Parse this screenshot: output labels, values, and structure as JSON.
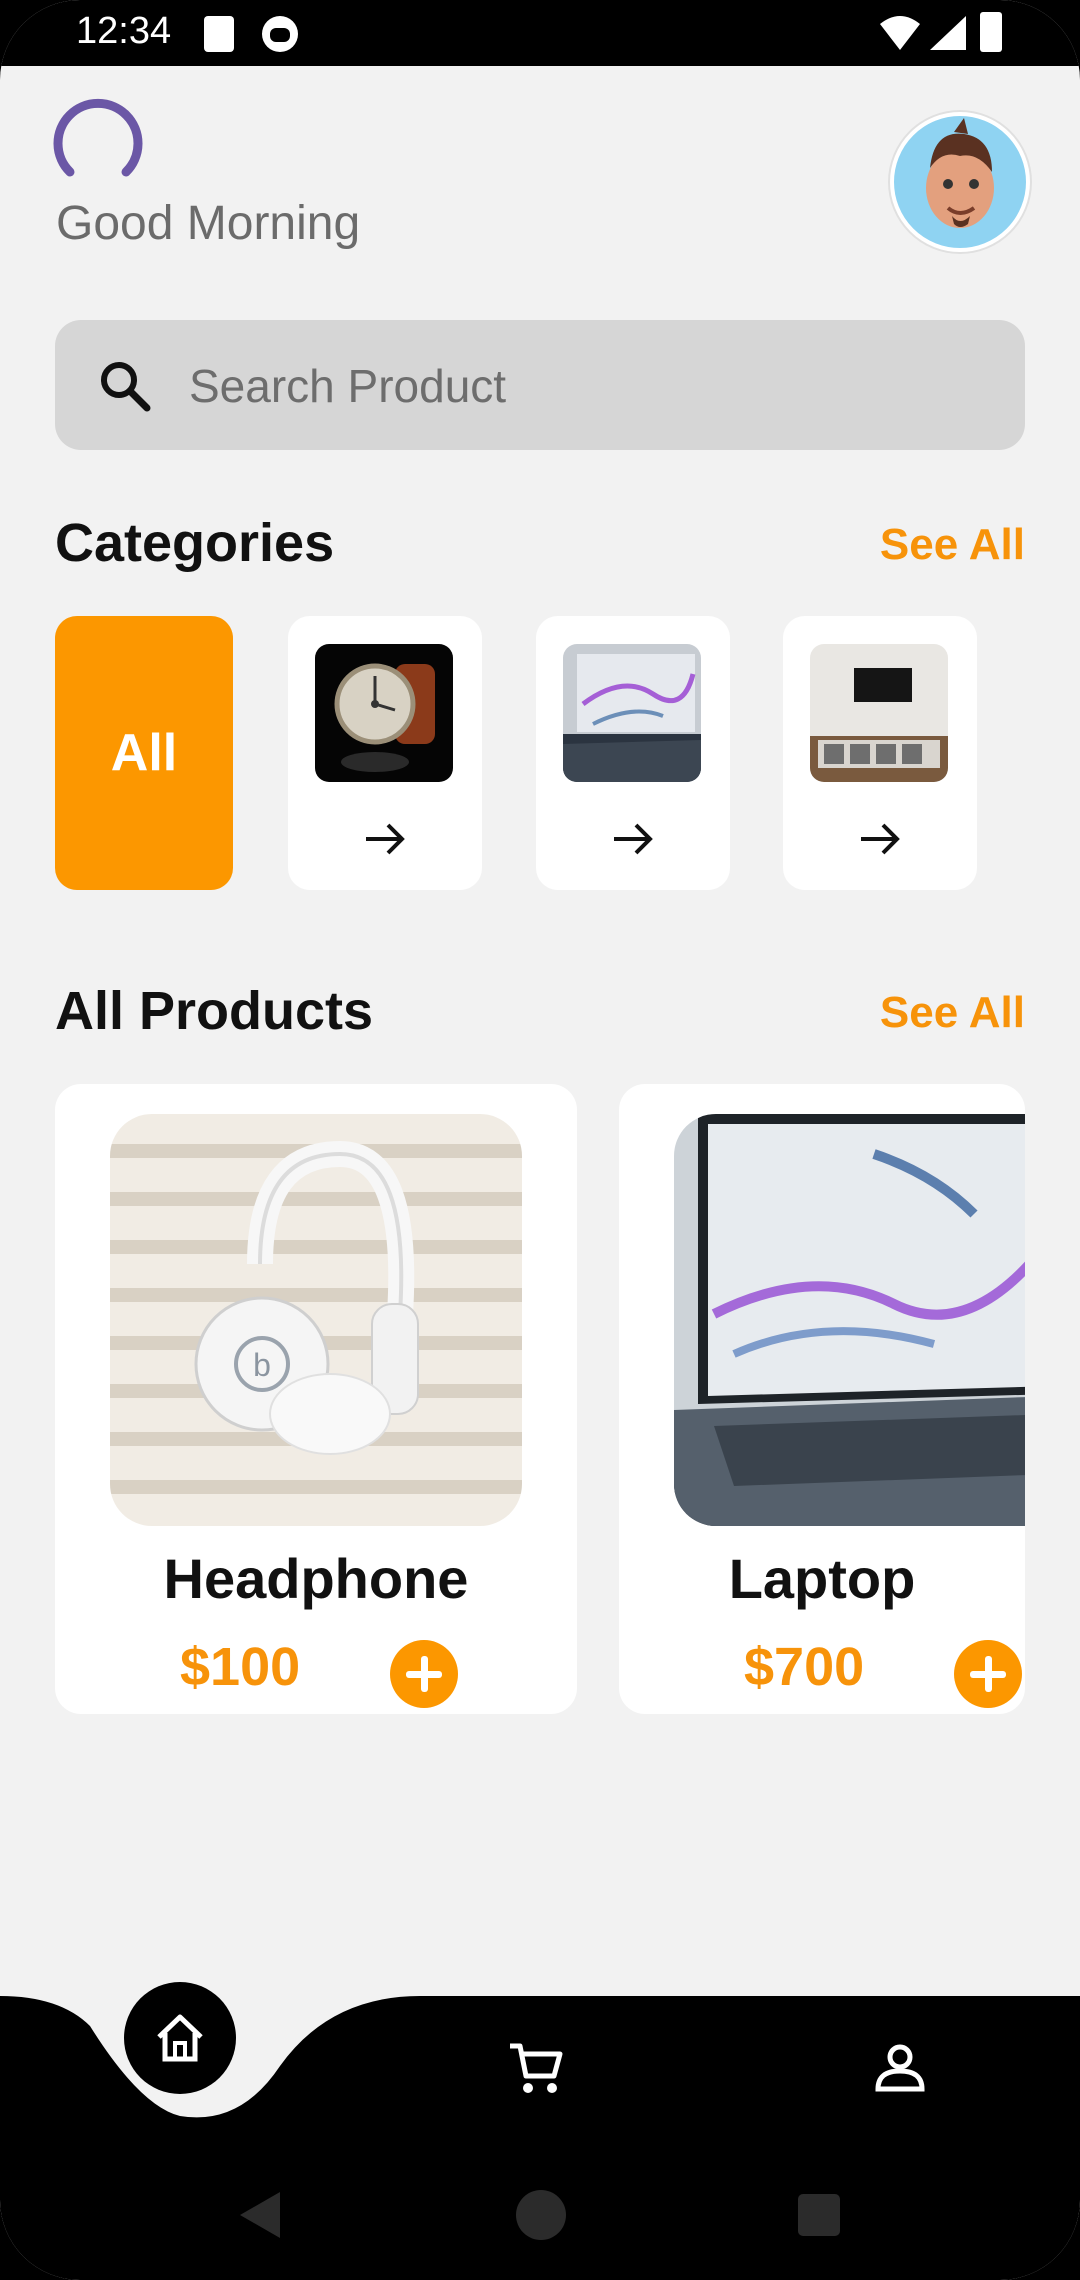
{
  "status_bar": {
    "time": "12:34"
  },
  "header": {
    "greeting": "Good Morning",
    "loader_color": "#6b57a6"
  },
  "search": {
    "placeholder": "Search Product",
    "value": ""
  },
  "categories": {
    "title": "Categories",
    "see_all": "See All",
    "selected_label": "All",
    "items": [
      {
        "icon": "watch-image"
      },
      {
        "icon": "laptop-image"
      },
      {
        "icon": "tv-stand-image"
      }
    ]
  },
  "products": {
    "title": "All Products",
    "see_all": "See All",
    "items": [
      {
        "name": "Headphone",
        "price": "$100"
      },
      {
        "name": "Laptop",
        "price": "$700"
      }
    ]
  },
  "bottom_nav": {
    "items": [
      "home-icon",
      "cart-icon",
      "profile-icon"
    ],
    "accent": "#fc9700"
  }
}
